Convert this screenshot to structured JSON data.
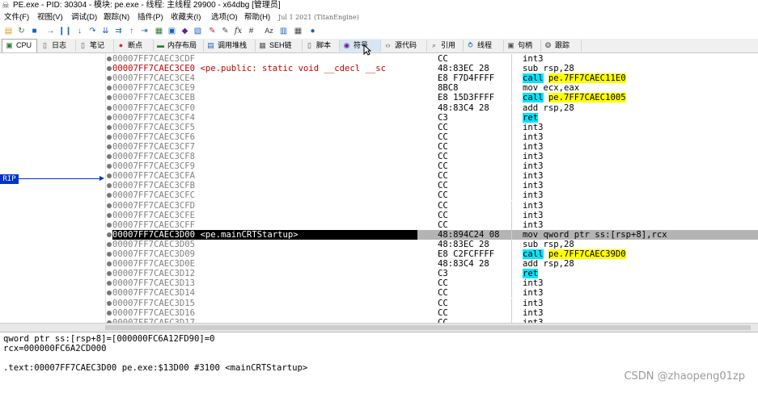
{
  "window": {
    "title": "PE.exe - PID: 30304 - 模块: pe.exe - 线程: 主线程 29900 - x64dbg [管理员]"
  },
  "menu": {
    "items": [
      "文件(F)",
      "视图(V)",
      "调试(D)",
      "跟踪(N)",
      "插件(P)",
      "收藏夹(I)",
      "选项(O)",
      "帮助(H)"
    ],
    "build": "Jul 1 2021 (TitanEngine)"
  },
  "toolbar": {
    "icons": [
      "open-icon",
      "restart-icon",
      "stop-icon",
      "run-icon",
      "pause-icon",
      "step-into-icon",
      "step-over-icon",
      "trace-into-icon",
      "trace-over-icon",
      "run-to-user-icon",
      "highlight-icon",
      "patch-icon",
      "comment-icon",
      "label-icon",
      "bookmark-icon",
      "function-icon",
      "hash-icon",
      "font-icon",
      "strings-icon",
      "calculator-icon",
      "notes-icon",
      "web-icon"
    ],
    "fx": "fx",
    "hash": "#",
    "az": "Az"
  },
  "tabs": [
    {
      "label": "CPU",
      "icon": "cpu-icon",
      "active": true
    },
    {
      "label": "日志",
      "icon": "log-icon"
    },
    {
      "label": "笔记",
      "icon": "notes-icon"
    },
    {
      "label": "断点",
      "icon": "breakpoint-icon"
    },
    {
      "label": "内存布局",
      "icon": "memory-icon"
    },
    {
      "label": "调用堆栈",
      "icon": "callstack-icon"
    },
    {
      "label": "SEH链",
      "icon": "seh-icon"
    },
    {
      "label": "脚本",
      "icon": "script-icon"
    },
    {
      "label": "符号",
      "icon": "symbols-icon",
      "hover": true
    },
    {
      "label": "源代码",
      "icon": "source-icon"
    },
    {
      "label": "引用",
      "icon": "references-icon"
    },
    {
      "label": "线程",
      "icon": "threads-icon"
    },
    {
      "label": "句柄",
      "icon": "handles-icon"
    },
    {
      "label": "跟踪",
      "icon": "trace-icon"
    }
  ],
  "rip_label": "RIP",
  "disasm": [
    {
      "addr": "00007FF7CAEC3CDF",
      "label": "",
      "bytes": "CC",
      "mnem": "int3"
    },
    {
      "addr": "00007FF7CAEC3CE0",
      "label": "<pe.public: static void __cdecl __sc",
      "bytes": "48:83EC 28",
      "mnem": "sub",
      "ops": "rsp,28",
      "cur": true
    },
    {
      "addr": "00007FF7CAEC3CE4",
      "label": "",
      "bytes": "E8 F7D4FFFF",
      "mnem": "call",
      "ops": "pe.7FF7CAEC11E0",
      "kind": "call"
    },
    {
      "addr": "00007FF7CAEC3CE9",
      "label": "",
      "bytes": "8BC8",
      "mnem": "mov",
      "ops": "ecx,eax"
    },
    {
      "addr": "00007FF7CAEC3CEB",
      "label": "",
      "bytes": "E8 15D3FFFF",
      "mnem": "call",
      "ops": "pe.7FF7CAEC1005",
      "kind": "call"
    },
    {
      "addr": "00007FF7CAEC3CF0",
      "label": "",
      "bytes": "48:83C4 28",
      "mnem": "add",
      "ops": "rsp,28"
    },
    {
      "addr": "00007FF7CAEC3CF4",
      "label": "",
      "bytes": "C3",
      "mnem": "ret",
      "kind": "ret"
    },
    {
      "addr": "00007FF7CAEC3CF5",
      "label": "",
      "bytes": "CC",
      "mnem": "int3"
    },
    {
      "addr": "00007FF7CAEC3CF6",
      "label": "",
      "bytes": "CC",
      "mnem": "int3"
    },
    {
      "addr": "00007FF7CAEC3CF7",
      "label": "",
      "bytes": "CC",
      "mnem": "int3"
    },
    {
      "addr": "00007FF7CAEC3CF8",
      "label": "",
      "bytes": "CC",
      "mnem": "int3"
    },
    {
      "addr": "00007FF7CAEC3CF9",
      "label": "",
      "bytes": "CC",
      "mnem": "int3"
    },
    {
      "addr": "00007FF7CAEC3CFA",
      "label": "",
      "bytes": "CC",
      "mnem": "int3"
    },
    {
      "addr": "00007FF7CAEC3CFB",
      "label": "",
      "bytes": "CC",
      "mnem": "int3"
    },
    {
      "addr": "00007FF7CAEC3CFC",
      "label": "",
      "bytes": "CC",
      "mnem": "int3"
    },
    {
      "addr": "00007FF7CAEC3CFD",
      "label": "",
      "bytes": "CC",
      "mnem": "int3"
    },
    {
      "addr": "00007FF7CAEC3CFE",
      "label": "",
      "bytes": "CC",
      "mnem": "int3"
    },
    {
      "addr": "00007FF7CAEC3CFF",
      "label": "",
      "bytes": "CC",
      "mnem": "int3"
    },
    {
      "addr": "00007FF7CAEC3D00",
      "label": "<pe.mainCRTStartup>",
      "bytes": "48:894C24 08",
      "mnem": "mov",
      "ops": "qword ptr ss:[rsp+8],rcx",
      "kind": "mem",
      "selected": true
    },
    {
      "addr": "00007FF7CAEC3D05",
      "label": "",
      "bytes": "48:83EC 28",
      "mnem": "sub",
      "ops": "rsp,28"
    },
    {
      "addr": "00007FF7CAEC3D09",
      "label": "",
      "bytes": "E8 C2FCFFFF",
      "mnem": "call",
      "ops": "pe.7FF7CAEC39D0",
      "kind": "call"
    },
    {
      "addr": "00007FF7CAEC3D0E",
      "label": "",
      "bytes": "48:83C4 28",
      "mnem": "add",
      "ops": "rsp,28"
    },
    {
      "addr": "00007FF7CAEC3D12",
      "label": "",
      "bytes": "C3",
      "mnem": "ret",
      "kind": "ret"
    },
    {
      "addr": "00007FF7CAEC3D13",
      "label": "",
      "bytes": "CC",
      "mnem": "int3"
    },
    {
      "addr": "00007FF7CAEC3D14",
      "label": "",
      "bytes": "CC",
      "mnem": "int3"
    },
    {
      "addr": "00007FF7CAEC3D15",
      "label": "",
      "bytes": "CC",
      "mnem": "int3"
    },
    {
      "addr": "00007FF7CAEC3D16",
      "label": "",
      "bytes": "CC",
      "mnem": "int3"
    },
    {
      "addr": "00007FF7CAEC3D17",
      "label": "",
      "bytes": "CC",
      "mnem": "int3"
    }
  ],
  "info": {
    "line1": "qword ptr ss:[rsp+8]=[000000FC6A12FD90]=0",
    "line2": "rcx=000000FC6A2CD000",
    "line3": ".text:00007FF7CAEC3D00 pe.exe:$13D00 #3100 <mainCRTStartup>"
  },
  "watermark": "CSDN @zhaopeng01zp",
  "colors": {
    "call_highlight": "#00e5ff",
    "target_highlight": "#ffff00",
    "rip": "#0033cc",
    "label_red": "#cc0000"
  }
}
